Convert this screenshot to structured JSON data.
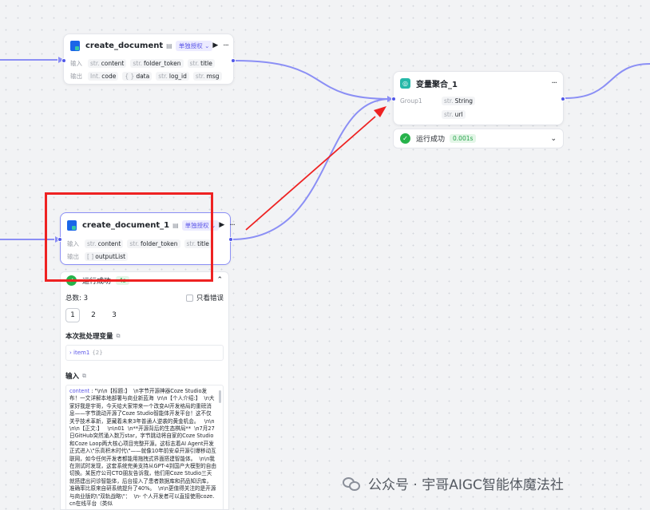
{
  "nodes": {
    "doc1": {
      "title": "create_document",
      "badge": "单独授权",
      "input_label": "输入",
      "output_label": "输出",
      "inputs": [
        {
          "type": "str.",
          "name": "content"
        },
        {
          "type": "str.",
          "name": "folder_token"
        },
        {
          "type": "str.",
          "name": "title"
        }
      ],
      "outputs": [
        {
          "type": "Int.",
          "name": "code"
        },
        {
          "type": "{ }",
          "name": "data"
        },
        {
          "type": "str.",
          "name": "log_id"
        },
        {
          "type": "str.",
          "name": "msg"
        }
      ]
    },
    "doc2": {
      "title": "create_document_1",
      "badge": "单独授权",
      "input_label": "输入",
      "output_label": "输出",
      "inputs": [
        {
          "type": "str.",
          "name": "content"
        },
        {
          "type": "str.",
          "name": "folder_token"
        },
        {
          "type": "str.",
          "name": "title"
        }
      ],
      "outputs": [
        {
          "type": "[ ]",
          "name": "outputList"
        }
      ]
    },
    "agg": {
      "title": "变量聚合_1",
      "group_label": "Group1",
      "vars": [
        {
          "type": "str.",
          "name": "String"
        },
        {
          "type": "str.",
          "name": "url"
        }
      ],
      "status": {
        "text": "运行成功",
        "time": "0.001s"
      }
    }
  },
  "result_panel": {
    "status_text": "运行成功",
    "status_time": "4s",
    "total_label": "总数: 3",
    "only_errors_label": "只看错误",
    "pages": [
      "1",
      "2",
      "3"
    ],
    "batch_vars_title": "本次批处理变量",
    "batch_item": "item1",
    "batch_count": "{2}",
    "input_title": "输入",
    "json_key": "content",
    "json_body": " : \"\\n\\n【标题:】  \\n字节开源神器Coze Studio发布！一文详解本地部署与商业新蓝海  \\n\\n【个人介绍:】  \\n大家好我是宇哥，今天给大家带来一个改变AI开发格局的重磅消息——字节跳动开源了Coze Studio智能体开发平台！这不仅关乎技术革新，更藏着未来3年普通人逆袭的黄金机会。   \\n\\n\n\\n\\n【正文:】   \\n\\n01  \\n**开源背后的生态棋局**  \\n7月27日GitHub突然涌入数万star，字节跳动将自家的Coze Studio和Coze Loop两大核心项目完整开源。这标志着AI Agent开发正式进入\\\"乐高积木时代\\\"——就像10年前安卓开源引爆移动互联网，如今任何开发者都能用拖拽式界面搭建智能体。  \\n\\n我在测试时发现，这套系统完美支持从GPT-4到国产大模型的自由切换。某医疗公司CTO朋友告诉我，他们用Coze Studio三天就搭建出问诊智能体，后台接入了患者数据库和药品知识库，准确率比原来自研系统提升了40%。  \\n\\n更值得关注的是开源与商业版的\\\"双轨战略\\\"：  \\n- 个人开发者可以直接使用coze.cn在线平台（类似"
  },
  "watermark": "公众号 · 宇哥AIGC智能体魔法社",
  "colors": {
    "accent": "#5057e8",
    "wire": "#8b8ff5",
    "success": "#27b34b",
    "highlight": "#ee2222"
  }
}
